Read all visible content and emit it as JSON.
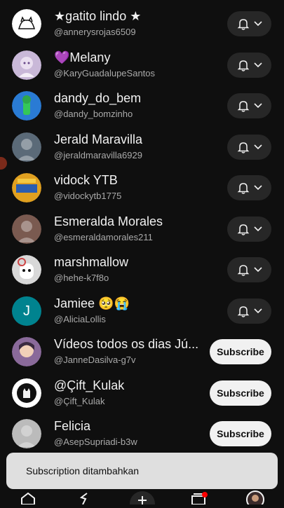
{
  "channels": [
    {
      "name": "★gatito lindo ★",
      "handle": "@annerysrojas6509",
      "action": "bell",
      "avatar_icon": "cat-drawing-icon",
      "avatar_color": "#ffffff"
    },
    {
      "name": "💜Melany",
      "handle": "@KaryGuadalupeSantos",
      "action": "bell",
      "avatar_icon": "anime-girl-icon",
      "avatar_color": "#c9b8d8"
    },
    {
      "name": "dandy_do_bem",
      "handle": "@dandy_bomzinho",
      "action": "bell",
      "avatar_icon": "green-character-icon",
      "avatar_color": "#2a7bd4"
    },
    {
      "name": "Jerald Maravilla",
      "handle": "@jeraldmaravilla6929",
      "action": "bell",
      "avatar_icon": "person-photo-icon",
      "avatar_color": "#5b6a78"
    },
    {
      "name": "vidock YTB",
      "handle": "@vidockytb1775",
      "action": "bell",
      "avatar_icon": "game-logo-icon",
      "avatar_color": "#e0a020"
    },
    {
      "name": "Esmeralda Morales",
      "handle": "@esmeraldamorales211",
      "action": "bell",
      "avatar_icon": "person-photo-icon",
      "avatar_color": "#7a5a50"
    },
    {
      "name": "marshmallow",
      "handle": "@hehe-k7f8o",
      "action": "bell",
      "avatar_icon": "marshmallow-icon",
      "avatar_color": "#d8d8d8"
    },
    {
      "name": "Jamiee 🥺😭",
      "handle": "@AliciaLollis",
      "action": "bell",
      "avatar_letter": "J",
      "avatar_color": "#00838f"
    },
    {
      "name": "Vídeos todos os dias Jú...",
      "handle": "@JanneDasilva-g7v",
      "action": "subscribe",
      "avatar_icon": "anime-character-icon",
      "avatar_color": "#8a6a9a"
    },
    {
      "name": "@Çift_Kulak",
      "handle": "@Çift_Kulak",
      "action": "subscribe",
      "avatar_icon": "cat-silhouette-icon",
      "avatar_color": "#ffffff"
    },
    {
      "name": "Felicia",
      "handle": "@AsepSupriadi-b3w",
      "action": "subscribe",
      "avatar_icon": "person-photo-icon",
      "avatar_color": "#bbbbbb"
    }
  ],
  "subscribe_label": "Subscribe",
  "toast": {
    "text": "Subscription ditambahkan"
  },
  "nav": [
    "home-icon",
    "shorts-icon",
    "create-icon",
    "subscriptions-icon",
    "profile-avatar-icon"
  ],
  "colors": {
    "background": "#0f0f0f",
    "button_dark": "#272727",
    "subscribe_bg": "#f1f1f1",
    "badge": "#ff0000"
  }
}
